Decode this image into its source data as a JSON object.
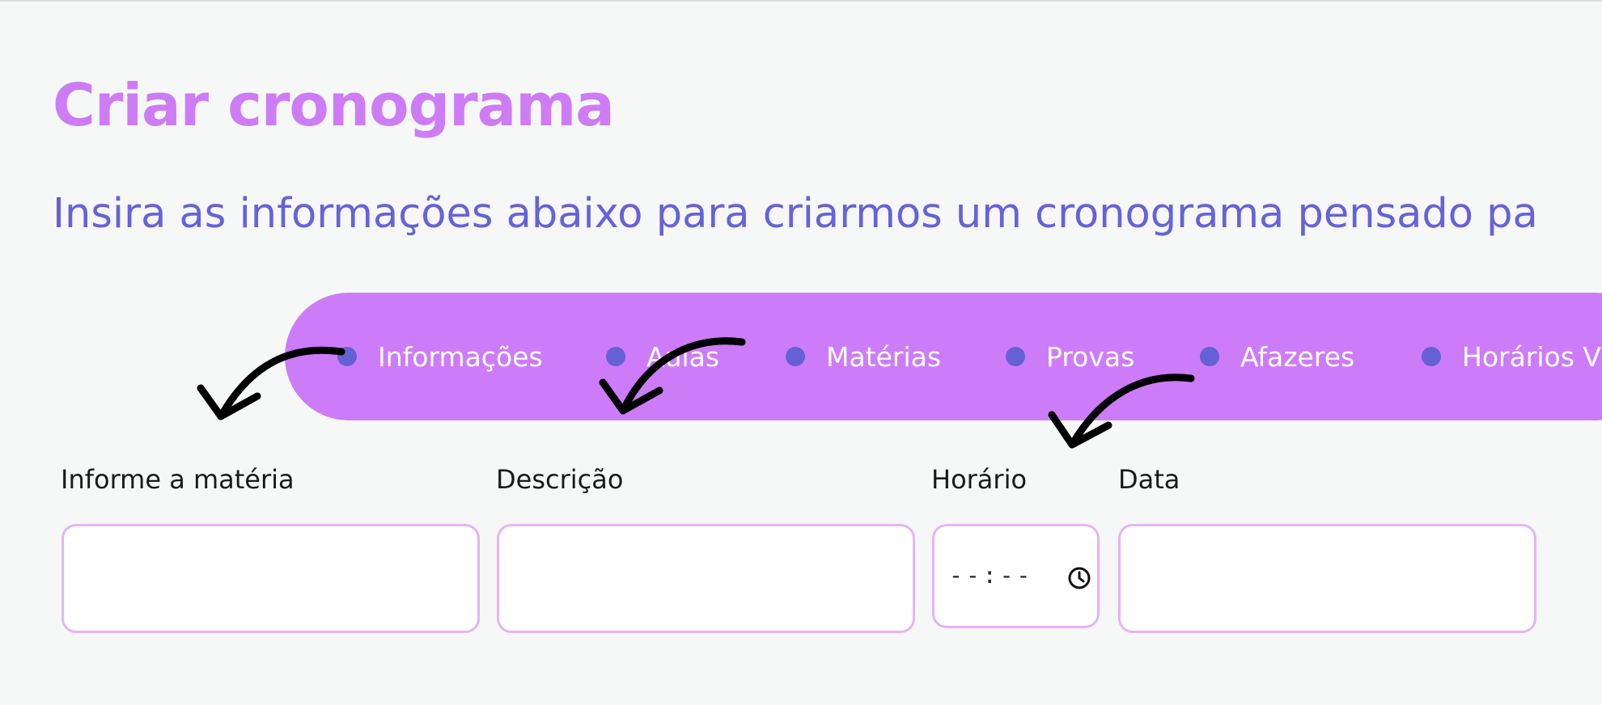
{
  "header": {
    "title": "Criar cronograma",
    "subtitle": "Insira as informações abaixo para criarmos um cronograma pensado pa"
  },
  "stepper": {
    "steps": [
      {
        "label": "Informações"
      },
      {
        "label": "Aulas"
      },
      {
        "label": "Matérias"
      },
      {
        "label": "Provas"
      },
      {
        "label": "Afazeres"
      },
      {
        "label": "Horários V"
      }
    ]
  },
  "form": {
    "subject": {
      "label": "Informe a matéria",
      "value": ""
    },
    "description": {
      "label": "Descrição",
      "value": ""
    },
    "time": {
      "label": "Horário",
      "placeholder": "--:--",
      "icon": "clock-icon"
    },
    "date": {
      "label": "Data",
      "value": ""
    }
  },
  "annotations": {
    "arrow_icon": "curved-arrow-icon",
    "arrow_color": "#000000"
  },
  "colors": {
    "accent": "#cd7cf9",
    "title": "#cd7cf6",
    "subtitle": "#6662d9",
    "dot": "#6461d5",
    "input_border": "#e6b3f6",
    "background": "#f6f7f7"
  }
}
